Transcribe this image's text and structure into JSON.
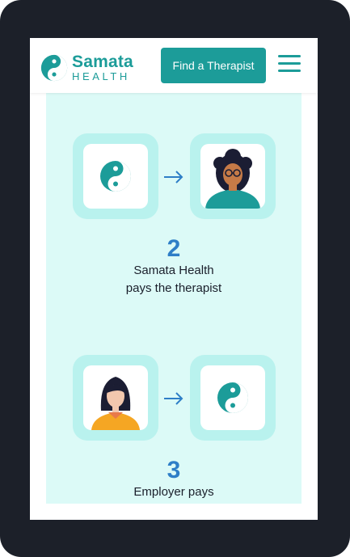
{
  "header": {
    "logo_title": "Samata",
    "logo_subtitle": "HEALTH",
    "cta_label": "Find a Therapist",
    "menu_icon": "hamburger-menu-icon"
  },
  "steps": [
    {
      "number": "2",
      "line1": "Samata Health",
      "line2": "pays the therapist",
      "from_icon": "yin-yang-logo-icon",
      "to_icon": "therapist-avatar-icon"
    },
    {
      "number": "3",
      "line1": "Employer pays",
      "from_icon": "employee-avatar-icon",
      "to_icon": "yin-yang-logo-icon"
    }
  ],
  "colors": {
    "brand": "#1c9c99",
    "panel_bg": "#dcfaf7",
    "tile_bg": "#b9f2ee",
    "number": "#2e7ec7",
    "arrow": "#2e7ec7",
    "device_frame": "#1c2029"
  }
}
